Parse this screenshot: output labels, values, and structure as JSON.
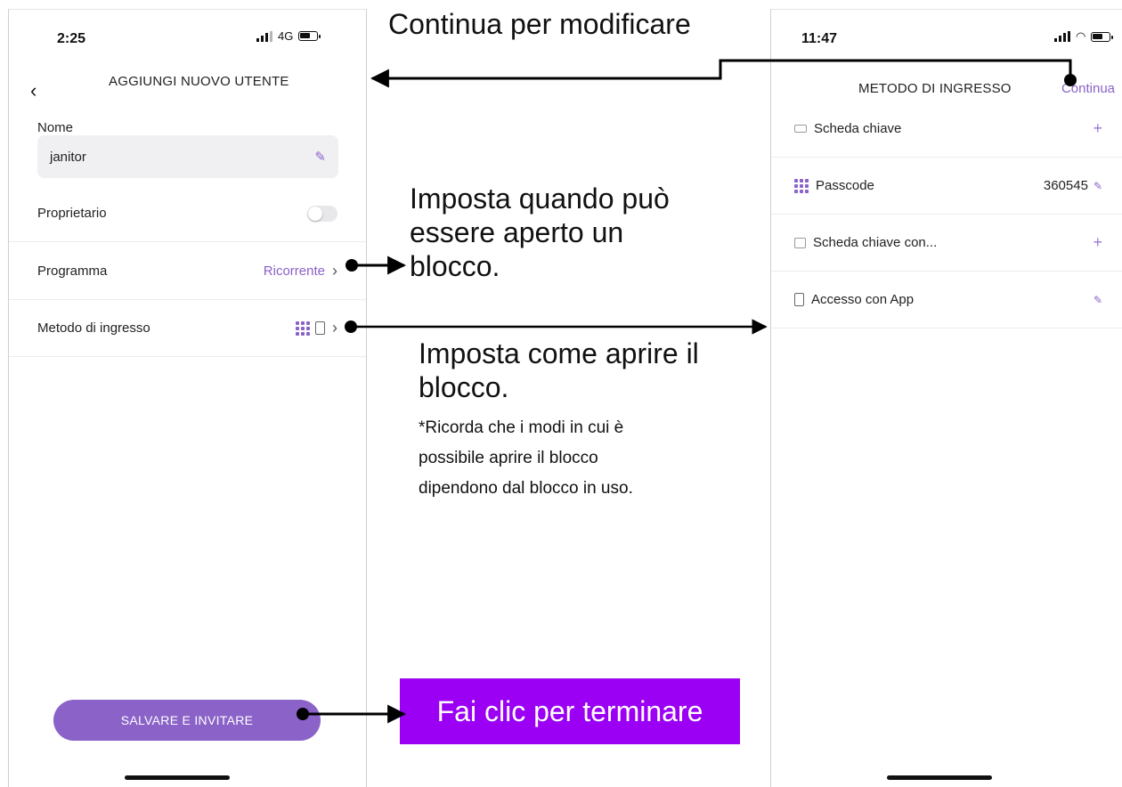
{
  "left_screen": {
    "status": {
      "time": "2:25",
      "network": "4G"
    },
    "header_title": "AGGIUNGI NUOVO UTENTE",
    "name": {
      "label": "Nome",
      "value": "janitor"
    },
    "owner": {
      "label": "Proprietario",
      "enabled": false
    },
    "schedule": {
      "label": "Programma",
      "value": "Ricorrente"
    },
    "entry": {
      "label": "Metodo di ingresso",
      "icons": [
        "keypad-icon",
        "phone-app-icon"
      ]
    },
    "save_button": "SALVARE E INVITARE"
  },
  "right_screen": {
    "status": {
      "time": "11:47"
    },
    "header_title": "METODO DI INGRESSO",
    "continue_label": "Continua",
    "methods": [
      {
        "label": "Scheda chiave",
        "icon": "key-card-icon",
        "action": "+"
      },
      {
        "label": "Passcode",
        "icon": "keypad-icon",
        "value": "360545",
        "action": "edit"
      },
      {
        "label": "Scheda chiave con...",
        "icon": "key-card-keypad-icon",
        "action": "+"
      },
      {
        "label": "Accesso con App",
        "icon": "phone-app-icon",
        "action": "edit"
      }
    ]
  },
  "annotations": {
    "edit_hint": "Continua per modificare",
    "schedule_hint_lines": [
      "Imposta quando può",
      "essere aperto un",
      "blocco."
    ],
    "entry_hint_lines": [
      "Imposta come aprire il",
      "blocco."
    ],
    "entry_note_lines": [
      "*Ricorda che i modi in cui è",
      "possibile aprire il blocco",
      "dipendono dal blocco in uso."
    ],
    "finish_hint": "Fai clic per terminare"
  },
  "colors": {
    "accent": "#8a62c8",
    "annotation_box": "#9b00f4"
  }
}
